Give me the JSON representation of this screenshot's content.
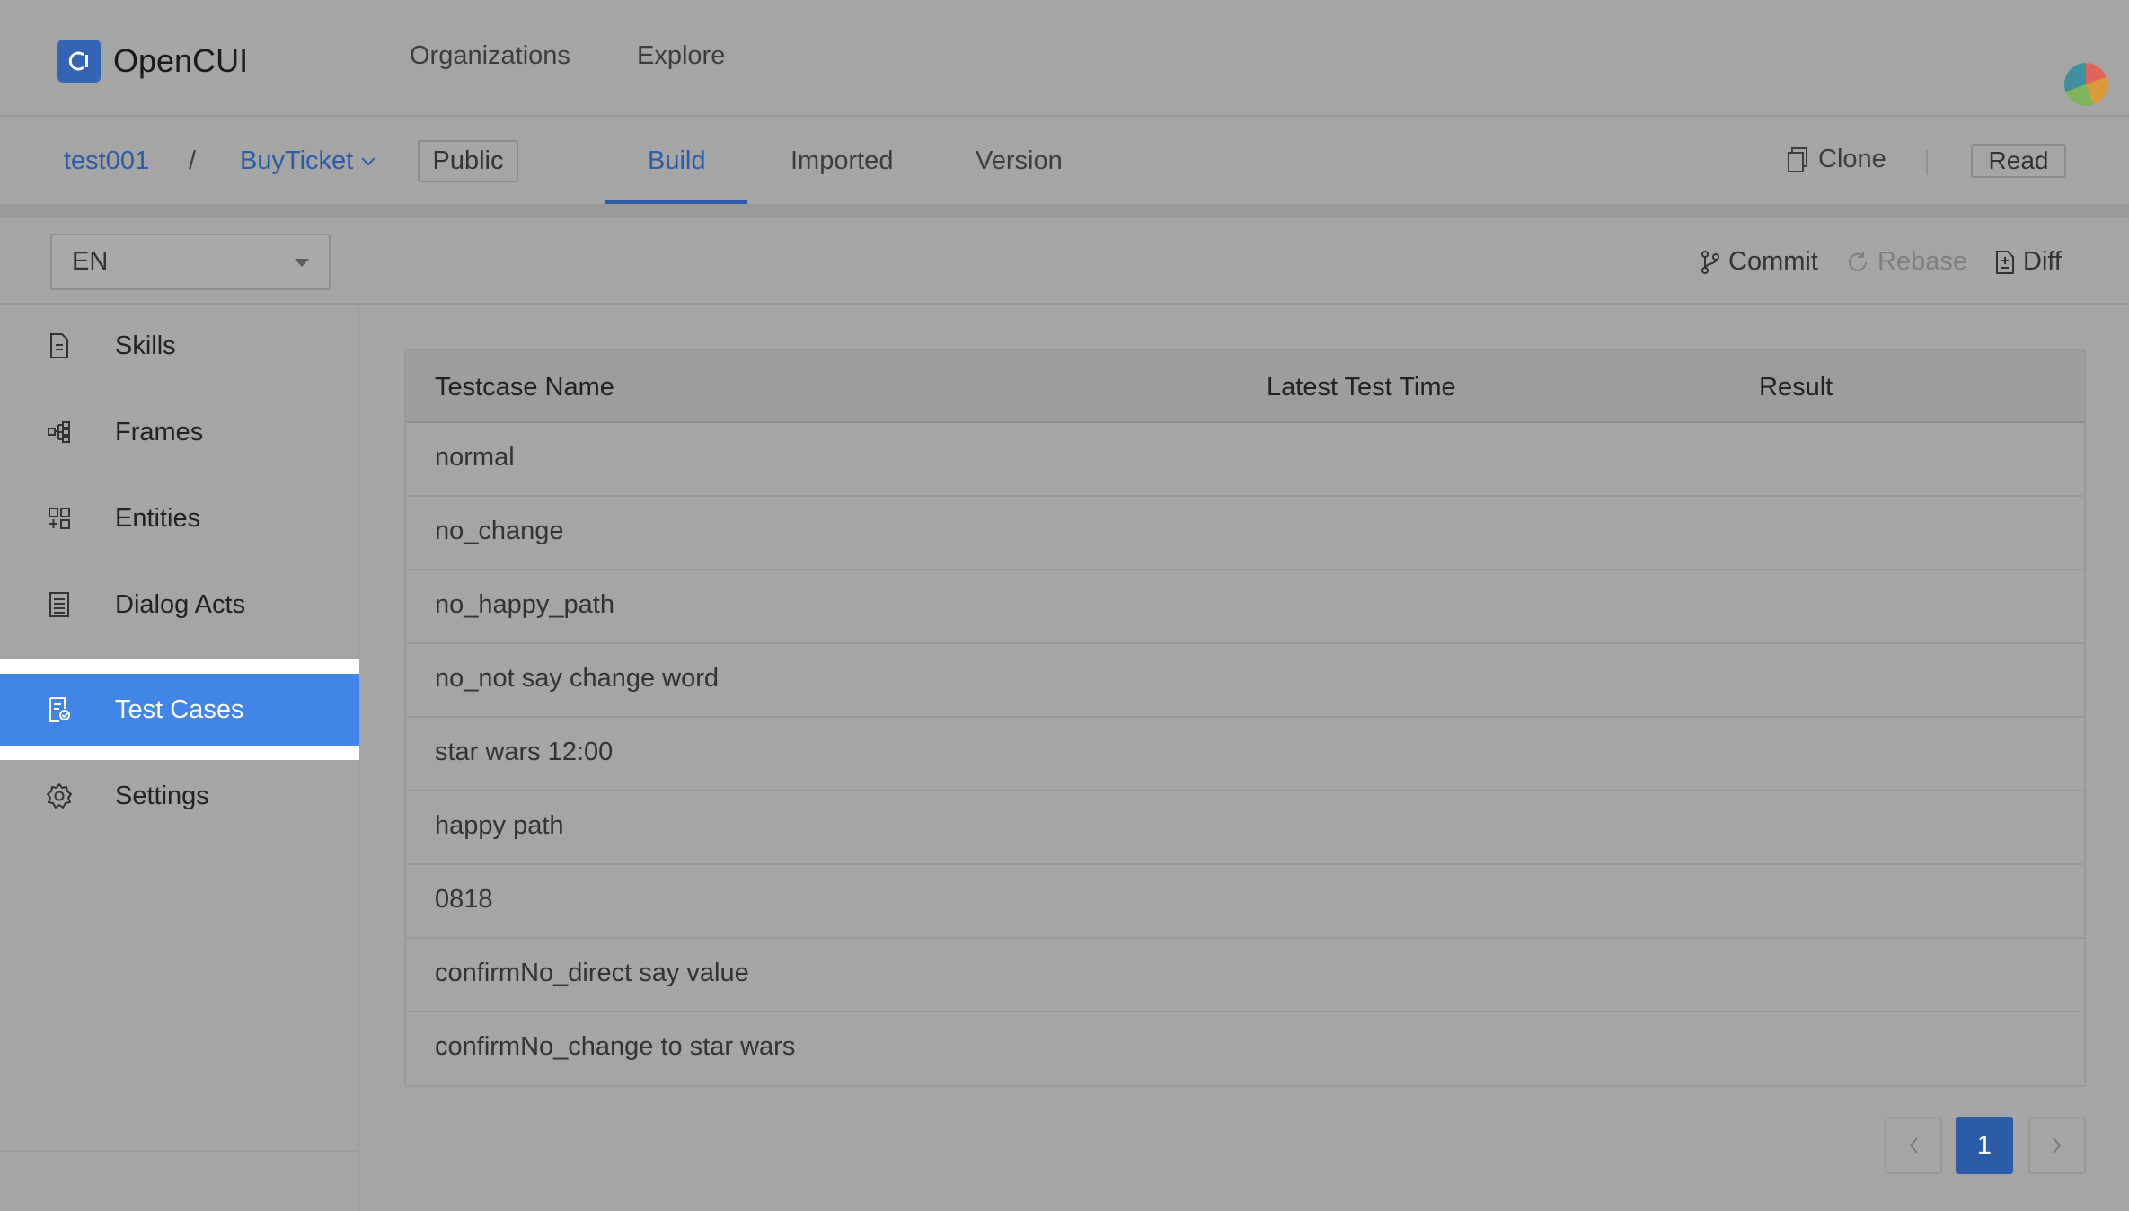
{
  "app": {
    "name": "OpenCUI"
  },
  "topnav": {
    "links": [
      "Organizations",
      "Explore"
    ]
  },
  "project": {
    "org": "test001",
    "separator": "/",
    "name": "BuyTicket",
    "visibility": "Public",
    "tabs": [
      "Build",
      "Imported",
      "Version"
    ],
    "active_tab": "Build",
    "clone_label": "Clone",
    "mode_label": "Read"
  },
  "toolbar": {
    "language": "EN",
    "commit_label": "Commit",
    "rebase_label": "Rebase",
    "diff_label": "Diff"
  },
  "sidebar": {
    "items": [
      {
        "label": "Skills",
        "icon": "document-icon"
      },
      {
        "label": "Frames",
        "icon": "hierarchy-icon"
      },
      {
        "label": "Entities",
        "icon": "grid-plus-icon"
      },
      {
        "label": "Dialog Acts",
        "icon": "list-document-icon"
      },
      {
        "label": "Test Cases",
        "icon": "test-document-icon"
      },
      {
        "label": "Settings",
        "icon": "gear-icon"
      }
    ],
    "active": "Test Cases"
  },
  "table": {
    "headers": [
      "Testcase Name",
      "Latest Test Time",
      "Result"
    ],
    "rows": [
      "normal",
      "no_change",
      "no_happy_path",
      "no_not say change word",
      "star wars 12:00",
      "happy path",
      "0818",
      "confirmNo_direct say value",
      "confirmNo_change to star wars"
    ]
  },
  "pagination": {
    "current_page": "1"
  },
  "colors": {
    "accent": "#2c5ba7",
    "active_item": "#4285e8",
    "background": "#a5a5a5"
  }
}
